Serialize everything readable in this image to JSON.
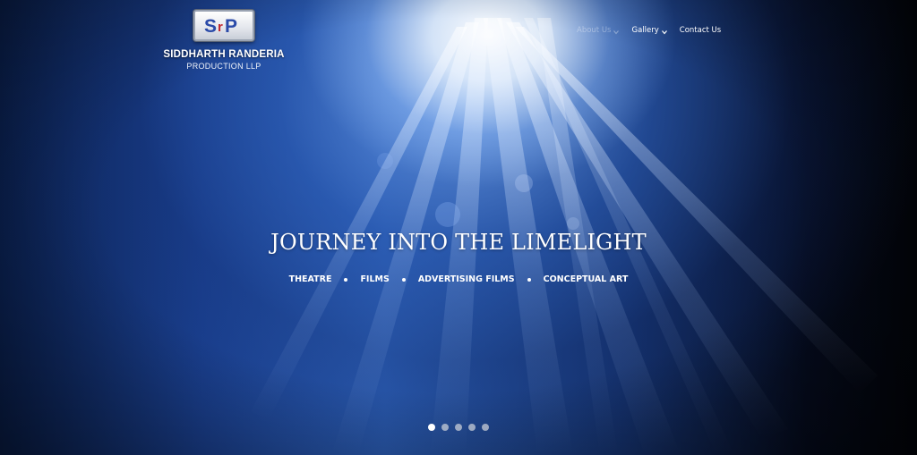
{
  "brand": {
    "logo_text": "SRP",
    "name_line1": "SIDDHARTH RANDERIA",
    "name_line2": "PRODUCTION LLP",
    "colors": {
      "badge_blue": "#2a4aa8",
      "badge_red": "#c0262e"
    }
  },
  "nav": {
    "items": [
      {
        "label": "About Us",
        "has_dropdown": true,
        "faded": true
      },
      {
        "label": "Gallery",
        "has_dropdown": true,
        "faded": false
      },
      {
        "label": "Contact Us",
        "has_dropdown": false,
        "faded": false
      }
    ]
  },
  "hero": {
    "headline": "JOURNEY INTO THE LIMELIGHT",
    "categories": [
      "THEATRE",
      "FILMS",
      "ADVERTISING FILMS",
      "CONCEPTUAL ART"
    ]
  },
  "slider": {
    "total": 5,
    "active_index": 0
  }
}
